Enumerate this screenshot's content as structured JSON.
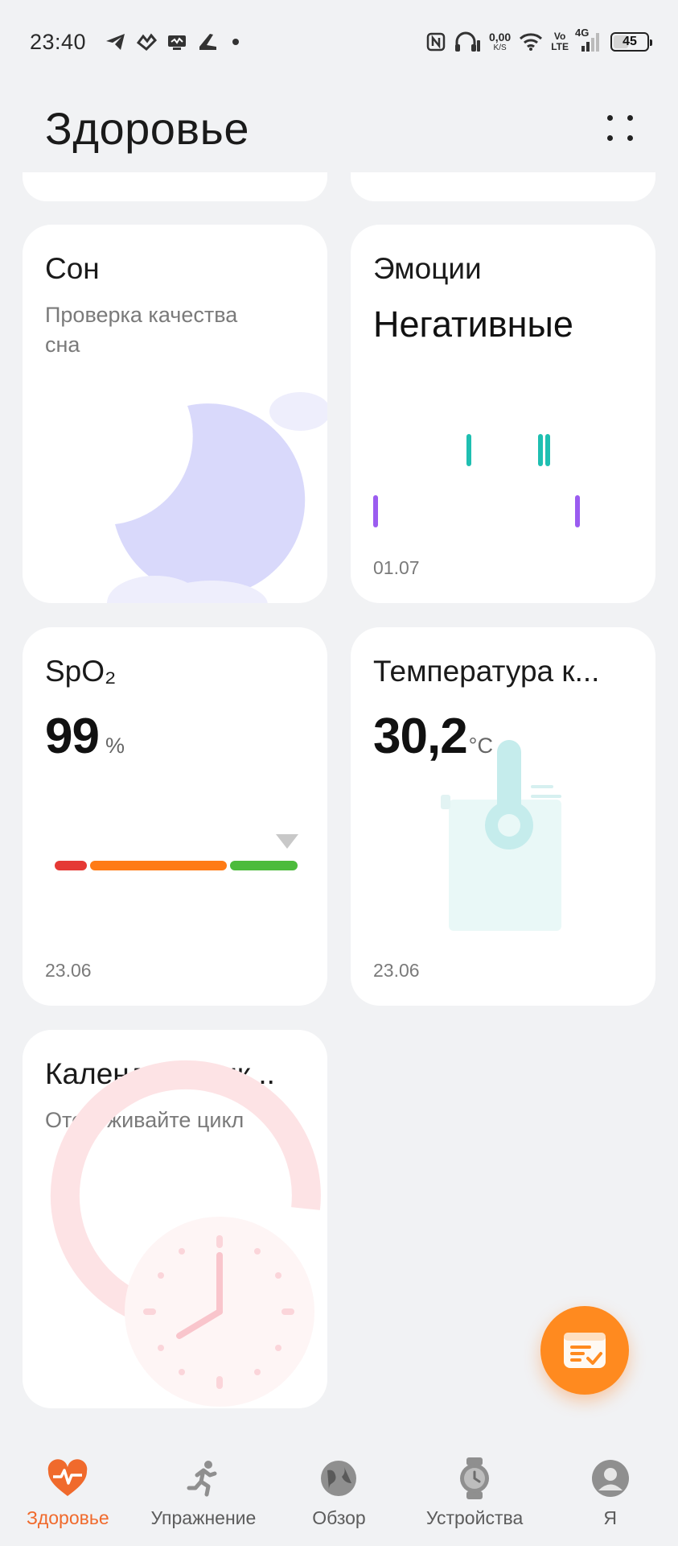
{
  "status_bar": {
    "time": "23:40",
    "speed_value": "0,00",
    "speed_unit": "K/S",
    "volte_top": "Vo",
    "volte_bottom": "LTE",
    "network": "4G",
    "battery": "45",
    "battery_level": 0.45,
    "icons": [
      "telegram-icon",
      "app-icon",
      "cast-icon",
      "shoe-icon",
      "dot-icon",
      "nfc-icon",
      "headphones-icon",
      "wifi-icon",
      "signal-icon",
      "battery-icon"
    ]
  },
  "header": {
    "title": "Здоровье",
    "more_icon": "more-grid-icon"
  },
  "cards": {
    "sleep": {
      "title": "Сон",
      "subtitle": "Проверка качества сна",
      "illustration": "moon-icon"
    },
    "emotions": {
      "title": "Эмоции",
      "value": "Негативные",
      "date": "01.07",
      "colors": {
        "positive": "#1fbfb1",
        "negative": "#9b5cf0"
      }
    },
    "spo2": {
      "title": "SpO₂",
      "value": "99",
      "unit": "%",
      "date": "23.06",
      "scale_colors": [
        "#e53935",
        "#ff7b15",
        "#4cbb3c"
      ]
    },
    "temperature": {
      "title": "Температура к...",
      "value": "30,2",
      "unit": "°C",
      "date": "23.06",
      "illustration": "thermometer-icon"
    },
    "cycle": {
      "title": "Календарь цик...",
      "subtitle": "Отслеживайте цикл",
      "illustration": "clock-icon"
    }
  },
  "fab": {
    "icon": "note-check-icon",
    "color": "#ff8a1f"
  },
  "bottom_nav": {
    "items": [
      {
        "label": "Здоровье",
        "icon": "heart-pulse-icon",
        "active": true
      },
      {
        "label": "Упражнение",
        "icon": "running-icon",
        "active": false
      },
      {
        "label": "Обзор",
        "icon": "globe-icon",
        "active": false
      },
      {
        "label": "Устройства",
        "icon": "watch-icon",
        "active": false
      },
      {
        "label": "Я",
        "icon": "user-icon",
        "active": false
      }
    ],
    "active_color": "#f06a2c"
  }
}
